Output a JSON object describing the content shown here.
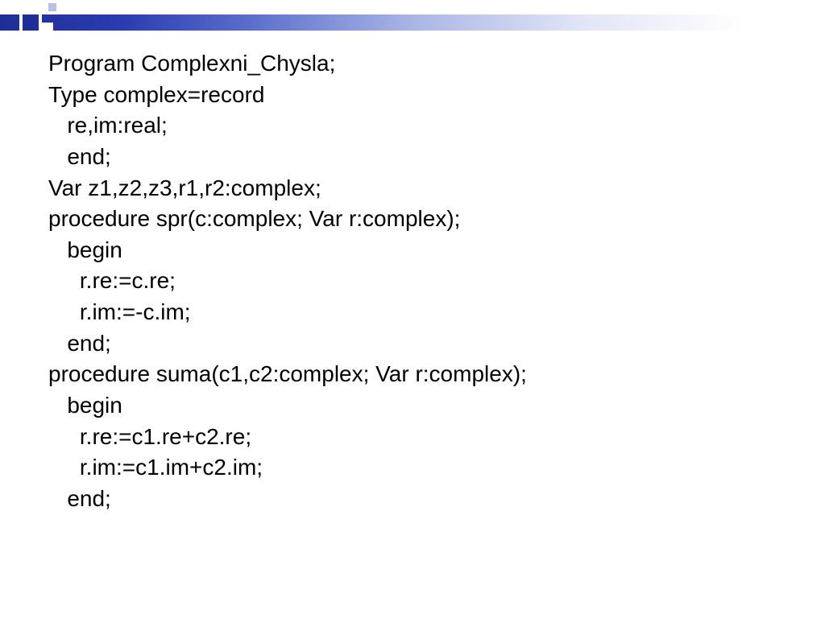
{
  "code": {
    "lines": [
      "Program Complexni_Chysla;",
      "Type complex=record",
      "   re,im:real;",
      "   end;",
      "Var z1,z2,z3,r1,r2:complex;",
      "procedure spr(c:complex; Var r:complex);",
      "   begin",
      "     r.re:=c.re;",
      "     r.im:=-c.im;",
      "   end;",
      "procedure suma(c1,c2:complex; Var r:complex);",
      "   begin",
      "     r.re:=c1.re+c2.re;",
      "     r.im:=c1.im+c2.im;",
      "   end;"
    ]
  }
}
